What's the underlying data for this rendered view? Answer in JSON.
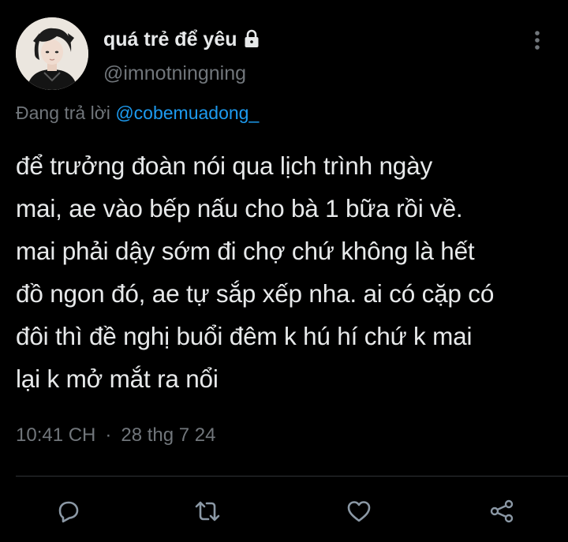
{
  "author": {
    "display_name": "quá trẻ để yêu",
    "handle": "@imnotningning",
    "protected_icon": "lock-icon",
    "avatar_icon": "profile-photo"
  },
  "reply": {
    "prefix": "Đang trả lời ",
    "handle": "@cobemuadong_"
  },
  "tweet": {
    "text": "để trưởng đoàn nói qua lịch trình ngày\nmai, ae vào bếp nấu cho bà 1 bữa rồi về.\nmai phải dậy sớm đi chợ chứ không là hết\nđồ ngon đó, ae tự sắp xếp nha. ai có cặp có\nđôi thì đề nghị buổi đêm k hú hí chứ k mai\nlại k mở mắt ra nổi"
  },
  "meta": {
    "time": "10:41 CH",
    "separator": "·",
    "date": "28 thg 7 24"
  },
  "actions": {
    "reply_icon": "reply-icon",
    "retweet_icon": "retweet-icon",
    "like_icon": "heart-icon",
    "share_icon": "share-icon",
    "more_icon": "more-vertical-icon"
  },
  "colors": {
    "background": "#000000",
    "text": "#e7e9ea",
    "secondary": "#71767b",
    "link": "#1d9bf0",
    "divider": "#2f3336"
  }
}
